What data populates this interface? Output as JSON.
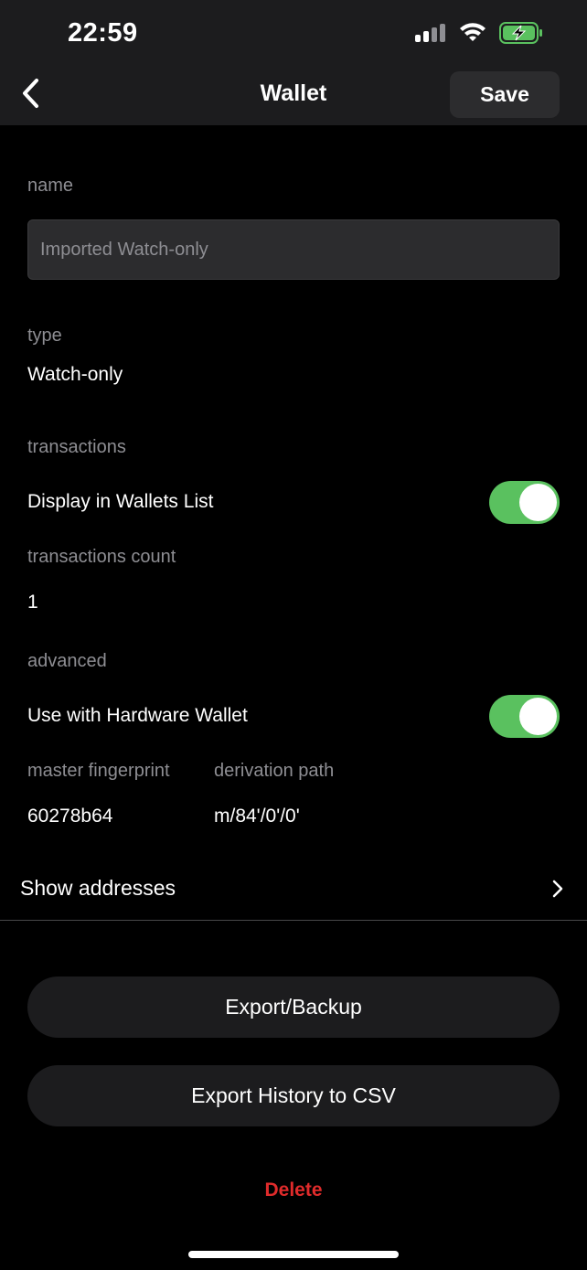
{
  "status_bar": {
    "time": "22:59",
    "icons": [
      "cellular-signal-icon",
      "wifi-icon",
      "battery-charging-icon"
    ],
    "battery_color": "#5ac15f"
  },
  "nav": {
    "back_icon": "chevron-left-icon",
    "title": "Wallet",
    "save_label": "Save"
  },
  "form": {
    "name_label": "name",
    "name_placeholder": "Imported Watch-only",
    "name_value": "",
    "type_label": "type",
    "type_value": "Watch-only",
    "transactions_label": "transactions",
    "display_in_list_label": "Display in Wallets List",
    "display_in_list_on": true,
    "transactions_count_label": "transactions count",
    "transactions_count_value": "1",
    "advanced_label": "advanced",
    "hardware_wallet_label": "Use with Hardware Wallet",
    "hardware_wallet_on": true,
    "fingerprint_label": "master fingerprint",
    "fingerprint_value": "60278b64",
    "derivation_label": "derivation path",
    "derivation_value": "m/84'/0'/0'"
  },
  "show_addresses": {
    "label": "Show addresses",
    "icon": "chevron-right-icon"
  },
  "actions": {
    "export_backup_label": "Export/Backup",
    "export_csv_label": "Export History to CSV",
    "delete_label": "Delete"
  },
  "colors": {
    "background": "#000000",
    "bar_background": "#1c1c1e",
    "toggle_on": "#5ac15f",
    "delete": "#e02b2b",
    "secondary_text": "#8e8e93"
  }
}
